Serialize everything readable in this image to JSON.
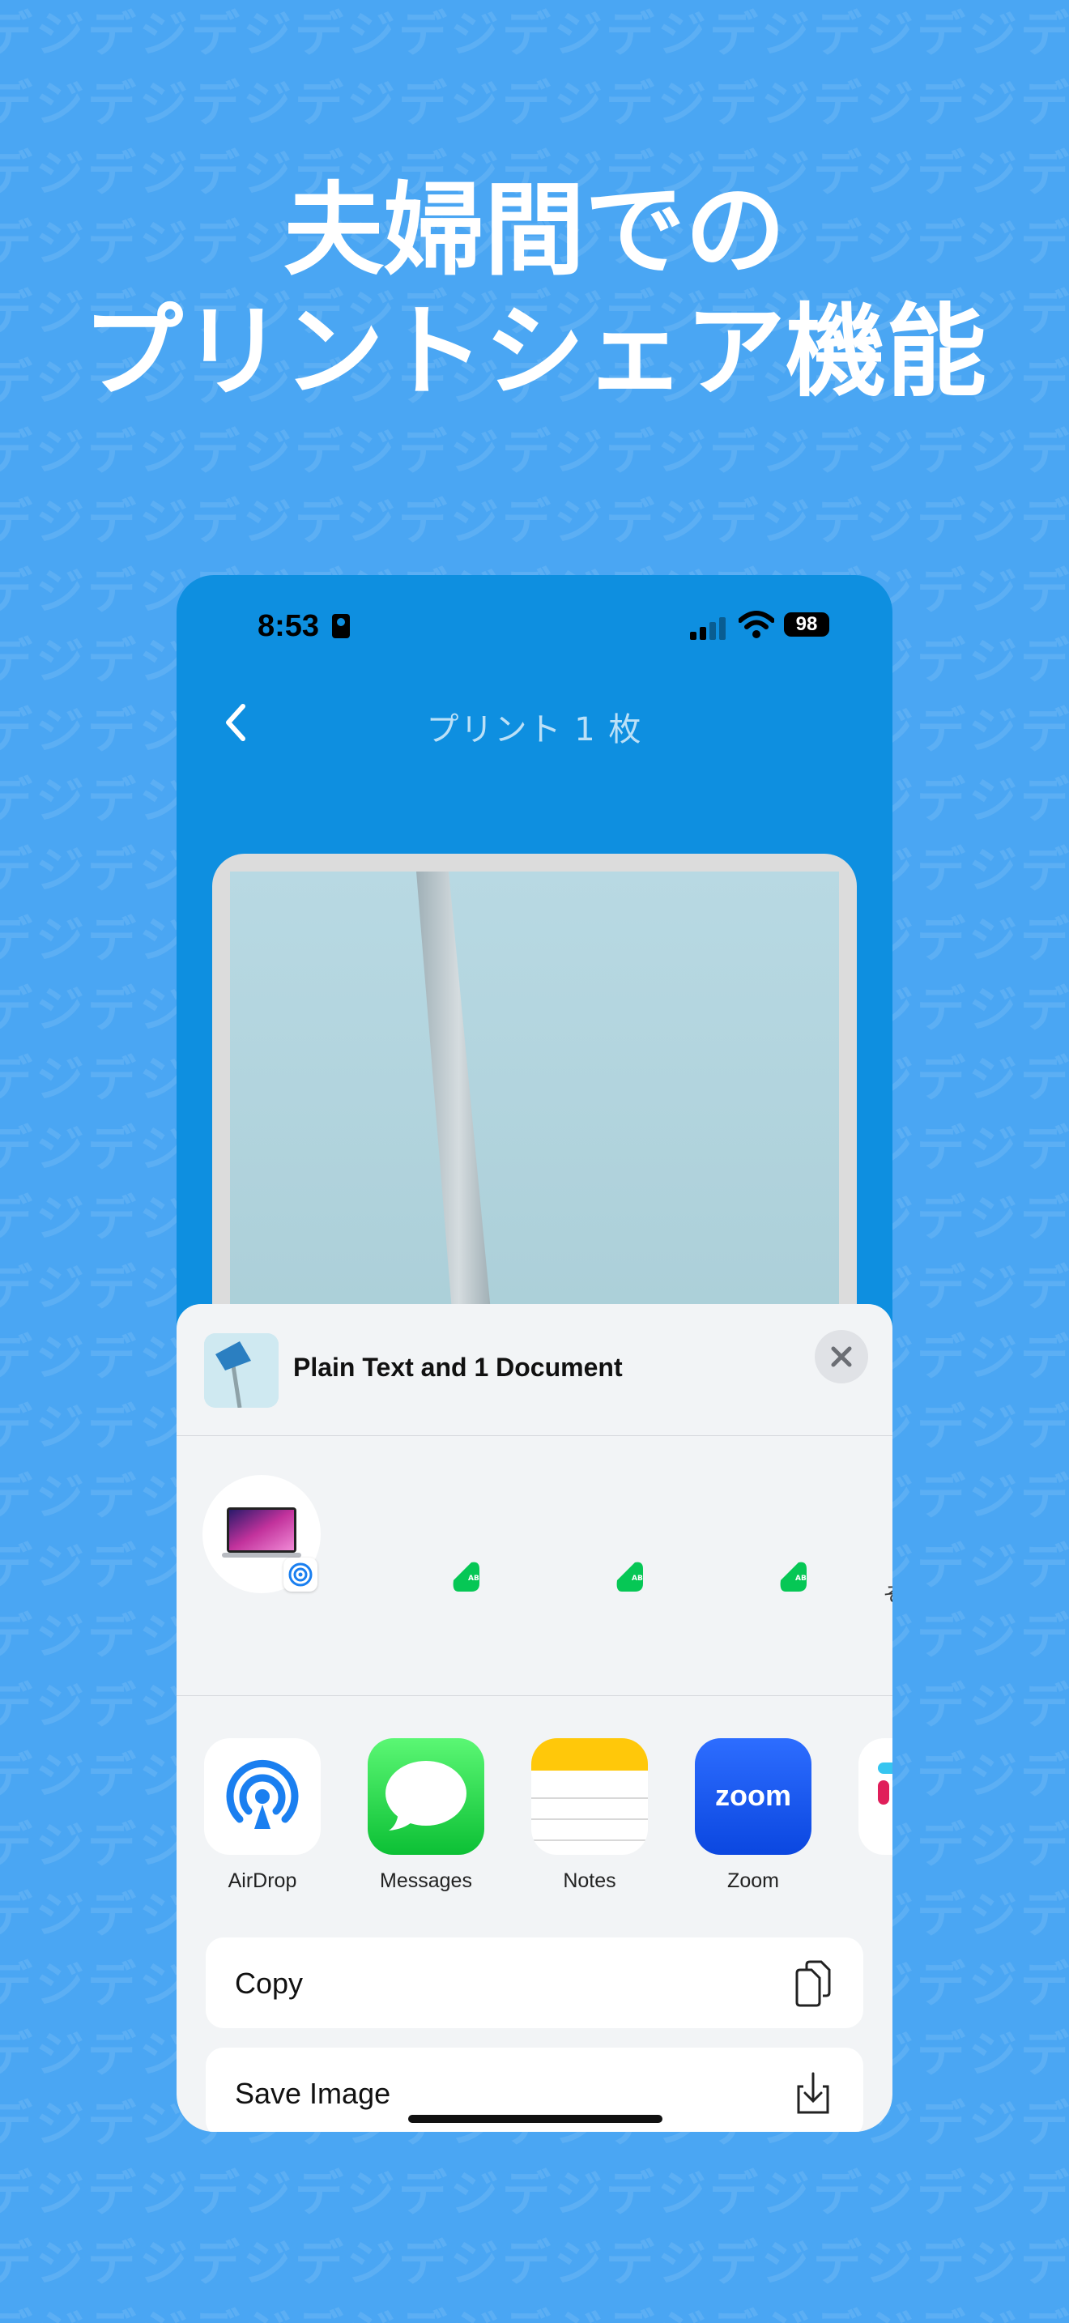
{
  "marketing": {
    "headline_line1": "夫婦間での",
    "headline_line2": "プリントシェア機能",
    "pattern_text": "デジデジデジデジデジデジデジデジデジデジデジデジ"
  },
  "status_bar": {
    "time": "8:53",
    "battery": "98"
  },
  "nav": {
    "title": "プリント 1 枚"
  },
  "share_sheet": {
    "title": "Plain Text and 1 Document",
    "people_row": {
      "cut_label": "そ"
    },
    "apps": [
      {
        "label": "AirDrop",
        "icon": "airdrop-icon"
      },
      {
        "label": "Messages",
        "icon": "messages-icon"
      },
      {
        "label": "Notes",
        "icon": "notes-icon"
      },
      {
        "label": "Zoom",
        "icon": "zoom-icon",
        "icon_text": "zoom"
      }
    ],
    "actions": [
      {
        "label": "Copy",
        "icon": "copy-icon"
      },
      {
        "label": "Save Image",
        "icon": "save-image-icon"
      }
    ]
  },
  "colors": {
    "background": "#4aa6f3",
    "app_header": "#0e8fe0",
    "sheet": "#f2f4f6",
    "line_green": "#06c755",
    "airdrop_blue": "#1a7ff0",
    "zoom_blue": "#0b5cff"
  }
}
